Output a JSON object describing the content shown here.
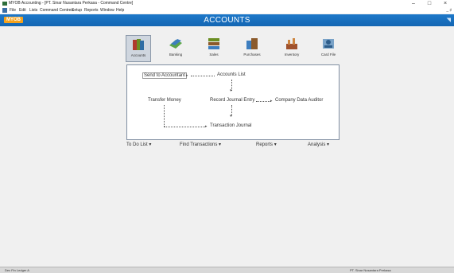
{
  "window": {
    "title": "MYOB Accounting - [PT. Sinar Nusantara Perkasa - Command Centre]",
    "minimize_glyph": "–",
    "maximize_glyph": "□",
    "close_glyph": "×"
  },
  "menubar": {
    "items": [
      "File",
      "Edit",
      "Lists",
      "Command Centres",
      "Setup",
      "Reports",
      "Window",
      "Help"
    ],
    "mdi_controls": "_ ♯"
  },
  "header": {
    "logo": "MYOB",
    "title": "ACCOUNTS"
  },
  "modules": [
    {
      "label": "Accounts",
      "icon": "accounts-icon",
      "active": true
    },
    {
      "label": "Banking",
      "icon": "banking-icon",
      "active": false
    },
    {
      "label": "Sales",
      "icon": "sales-icon",
      "active": false
    },
    {
      "label": "Purchases",
      "icon": "purchases-icon",
      "active": false
    },
    {
      "label": "Inventory",
      "icon": "inventory-icon",
      "active": false
    },
    {
      "label": "Card File",
      "icon": "card-file-icon",
      "active": false
    }
  ],
  "flow": {
    "send_to_accountant": "Send to Accountant",
    "accounts_list": "Accounts List",
    "transfer_money": "Transfer Money",
    "record_journal_entry": "Record Journal Entry",
    "company_data_auditor": "Company Data Auditor",
    "transaction_journal": "Transaction Journal"
  },
  "bottom_menus": {
    "to_do_list": "To Do List",
    "find_transactions": "Find Transactions",
    "reports": "Reports",
    "analysis": "Analysis"
  },
  "statusbar": {
    "left": "Dec Fin Ledger A",
    "right": "PT. Sinar Nusantara Perkasa"
  },
  "colors": {
    "header_blue": "#1d78c9",
    "logo_orange": "#f4a21d"
  }
}
